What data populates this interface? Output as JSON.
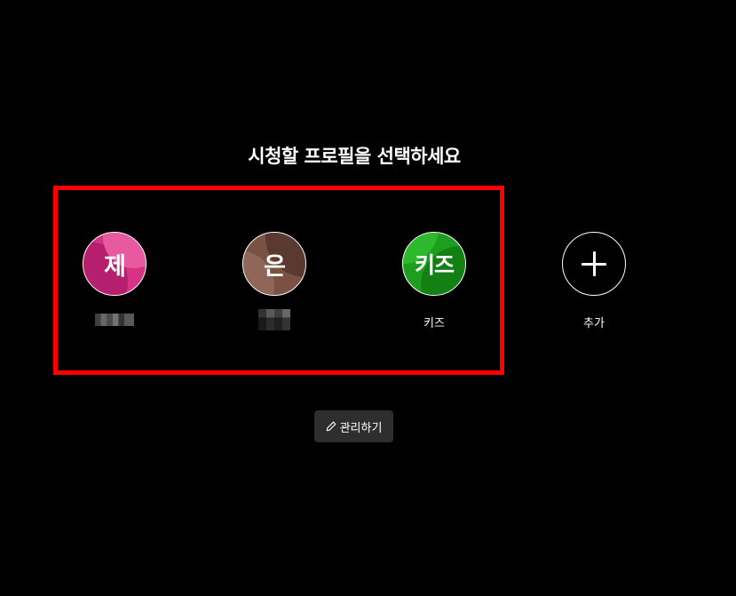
{
  "heading": "시청할 프로필을 선택하세요",
  "profiles": [
    {
      "initial": "제",
      "name": "",
      "color": "#d63384",
      "swirl": "#b51f6d"
    },
    {
      "initial": "은",
      "name": "",
      "color": "#7a5244",
      "swirl": "#5a3a30"
    },
    {
      "initial": "키즈",
      "name": "키즈",
      "color": "#1e9e1e",
      "swirl": "#138013"
    }
  ],
  "add_profile": {
    "label": "추가",
    "icon": "plus-icon"
  },
  "manage_button": {
    "label": "관리하기",
    "icon": "pencil-icon"
  },
  "colors": {
    "background": "#000000",
    "highlight": "#ff0000",
    "button_bg": "#2e2e2e"
  }
}
